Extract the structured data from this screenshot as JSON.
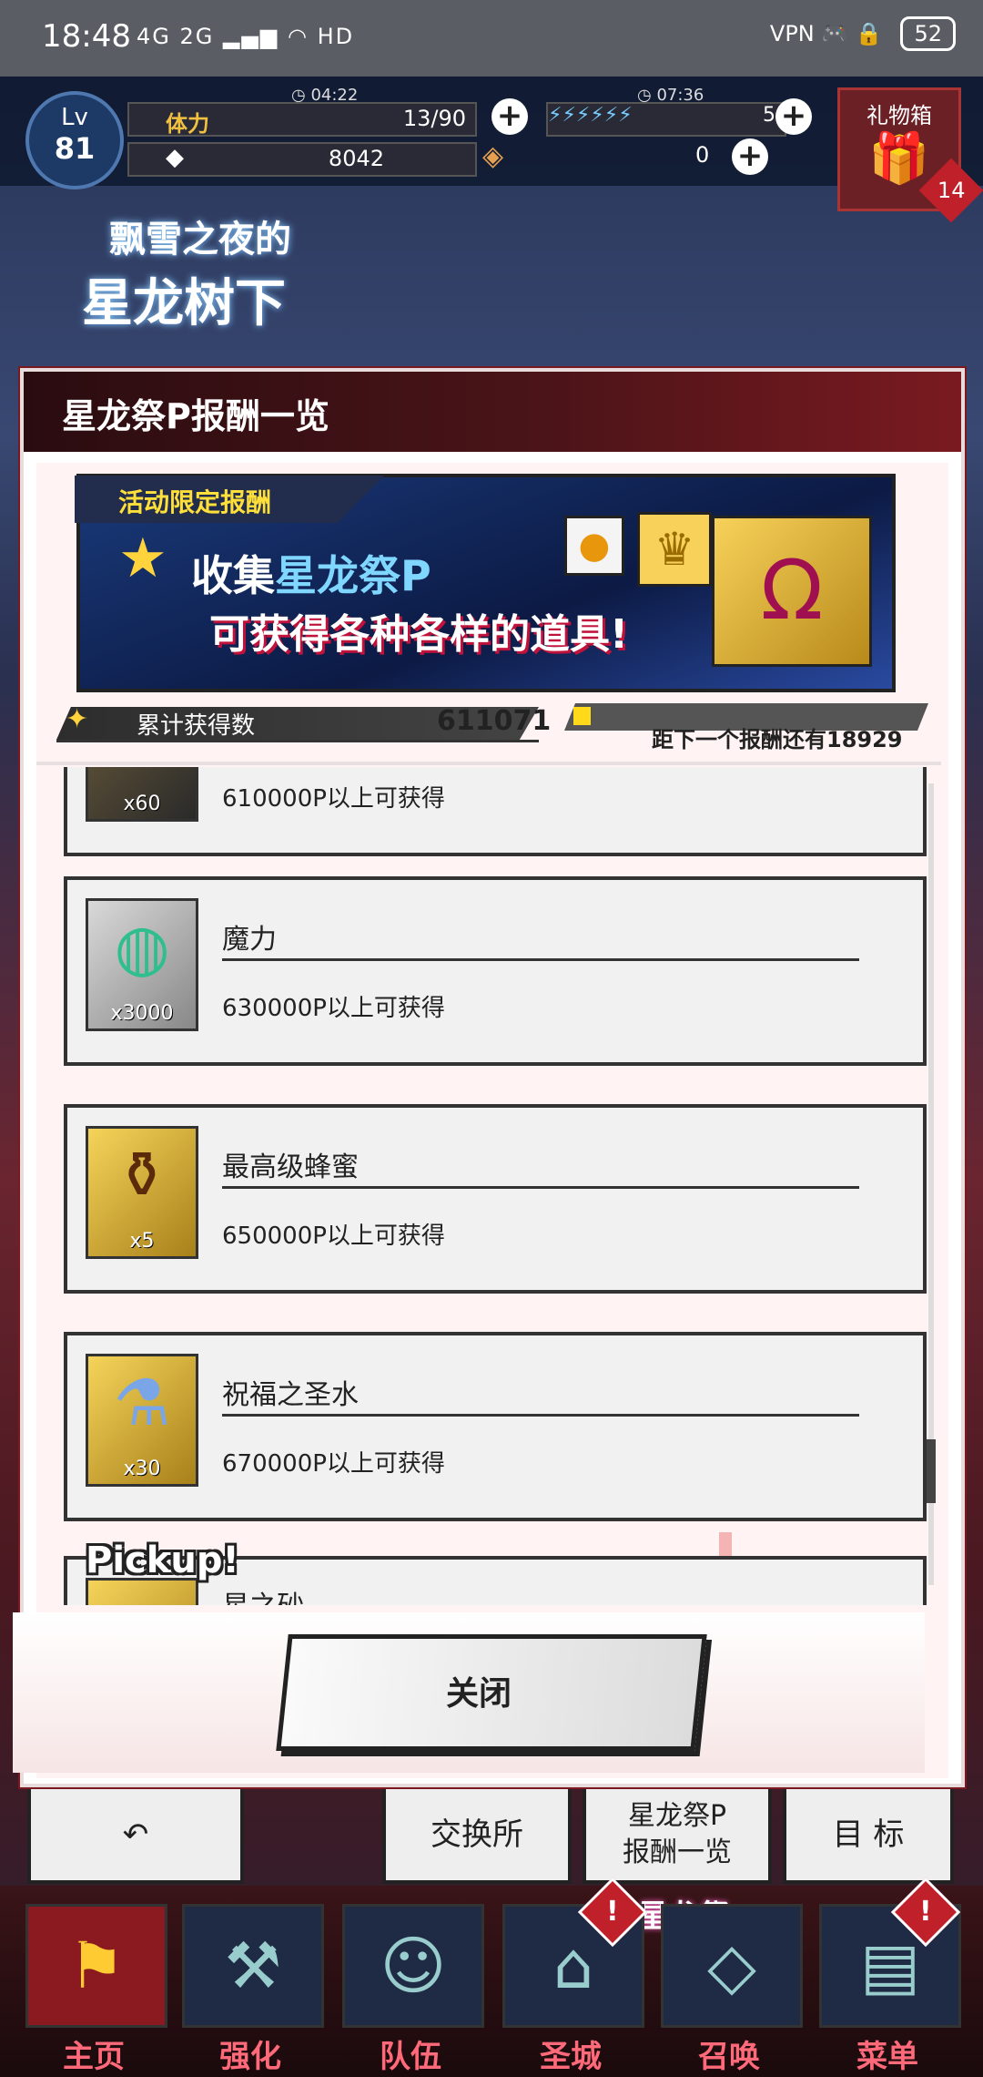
{
  "status_bar": {
    "time": "18:48",
    "signal": "4G 2G",
    "wifi": "HD",
    "vpn": "VPN",
    "battery": "52"
  },
  "game_header": {
    "level_label": "Lv",
    "level_value": "81",
    "stamina_label": "体力",
    "stamina_timer": "04:22",
    "stamina_value": "13/90",
    "gems_value": "8042",
    "energy_timer": "07:36",
    "energy_value": "5",
    "crystal_value": "0",
    "gift_box_label": "礼物箱",
    "gift_count": "14"
  },
  "event_banner": {
    "line1": "飘雪之夜的",
    "line2": "星龙树下"
  },
  "modal": {
    "title": "星龙祭P报酬一览",
    "promo": {
      "tag": "活动限定报酬",
      "line1_prefix": "收集",
      "line1_highlight": "星龙祭P",
      "line2": "可获得各种各样的道具!"
    },
    "accumulated_label": "累计获得数",
    "accumulated_value": "611071",
    "next_reward_text": "距下一个报酬还有18929",
    "next_reward_progress": 0.05,
    "rewards": [
      {
        "name": "",
        "qty": "x60",
        "requirement": "610000P以上可获得",
        "icon": "horseshoe-icon"
      },
      {
        "name": "魔力",
        "qty": "x3000",
        "requirement": "630000P以上可获得",
        "icon": "mana-orb-icon"
      },
      {
        "name": "最高级蜂蜜",
        "qty": "x5",
        "requirement": "650000P以上可获得",
        "icon": "honey-pot-icon"
      },
      {
        "name": "祝福之圣水",
        "qty": "x30",
        "requirement": "670000P以上可获得",
        "icon": "holy-water-icon"
      },
      {
        "name": "星之砂",
        "qty": "",
        "requirement": "",
        "icon": "star-sand-icon"
      }
    ],
    "pickup_label": "Pickup!",
    "close_label": "关闭"
  },
  "under_tiles": {
    "exchange": "交换所",
    "reward_list_line1": "星龙祭P",
    "reward_list_line2": "报酬一览",
    "goal": "目 标"
  },
  "bottom_nav": {
    "logo": "星龙祭",
    "items": [
      {
        "label": "主页",
        "icon": "home-banner-icon"
      },
      {
        "label": "强化",
        "icon": "anvil-icon"
      },
      {
        "label": "队伍",
        "icon": "party-icon"
      },
      {
        "label": "圣城",
        "icon": "castle-icon"
      },
      {
        "label": "召唤",
        "icon": "summon-crystal-icon"
      },
      {
        "label": "菜单",
        "icon": "book-icon"
      }
    ]
  },
  "colors": {
    "header_dark": "#2a0c10",
    "header_red": "#7a1a20",
    "nav_label": "#ff6a7a",
    "progress_fill": "#ffd91a"
  }
}
